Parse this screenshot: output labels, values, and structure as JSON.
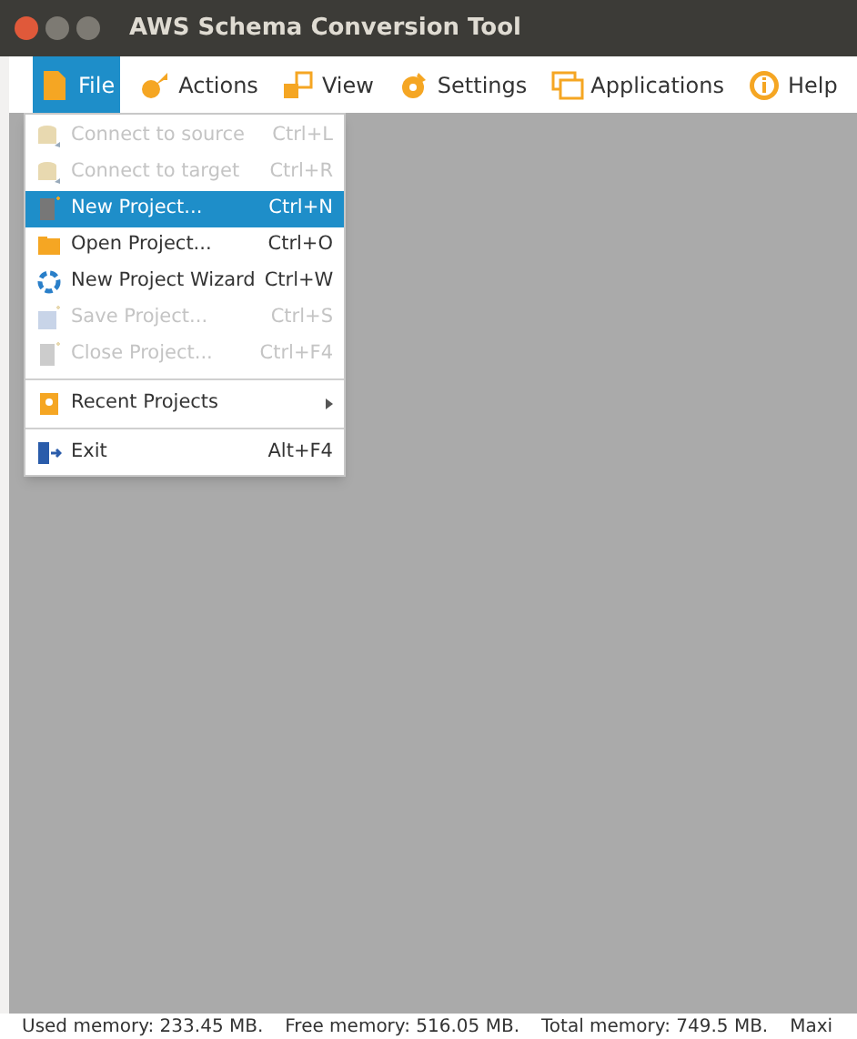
{
  "window": {
    "title": "AWS Schema Conversion Tool"
  },
  "menubar": [
    {
      "label": "File",
      "selected": true
    },
    {
      "label": "Actions",
      "selected": false
    },
    {
      "label": "View",
      "selected": false
    },
    {
      "label": "Settings",
      "selected": false
    },
    {
      "label": "Applications",
      "selected": false
    },
    {
      "label": "Help",
      "selected": false
    }
  ],
  "file_menu": [
    {
      "kind": "item",
      "label": "Connect to source",
      "shortcut": "Ctrl+L",
      "disabled": true,
      "selected": false
    },
    {
      "kind": "item",
      "label": "Connect to target",
      "shortcut": "Ctrl+R",
      "disabled": true,
      "selected": false
    },
    {
      "kind": "item",
      "label": "New Project...",
      "shortcut": "Ctrl+N",
      "disabled": false,
      "selected": true
    },
    {
      "kind": "item",
      "label": "Open Project...",
      "shortcut": "Ctrl+O",
      "disabled": false,
      "selected": false
    },
    {
      "kind": "item",
      "label": "New Project Wizard",
      "shortcut": "Ctrl+W",
      "disabled": false,
      "selected": false
    },
    {
      "kind": "item",
      "label": "Save Project...",
      "shortcut": "Ctrl+S",
      "disabled": true,
      "selected": false
    },
    {
      "kind": "item",
      "label": "Close Project...",
      "shortcut": "Ctrl+F4",
      "disabled": true,
      "selected": false
    },
    {
      "kind": "separator"
    },
    {
      "kind": "submenu",
      "label": "Recent Projects",
      "disabled": false,
      "selected": false
    },
    {
      "kind": "separator"
    },
    {
      "kind": "item",
      "label": "Exit",
      "shortcut": "Alt+F4",
      "disabled": false,
      "selected": false
    }
  ],
  "status_bar": [
    "Used memory: 233.45 MB.",
    "Free memory: 516.05 MB.",
    "Total memory: 749.5 MB.",
    "Maxi"
  ]
}
